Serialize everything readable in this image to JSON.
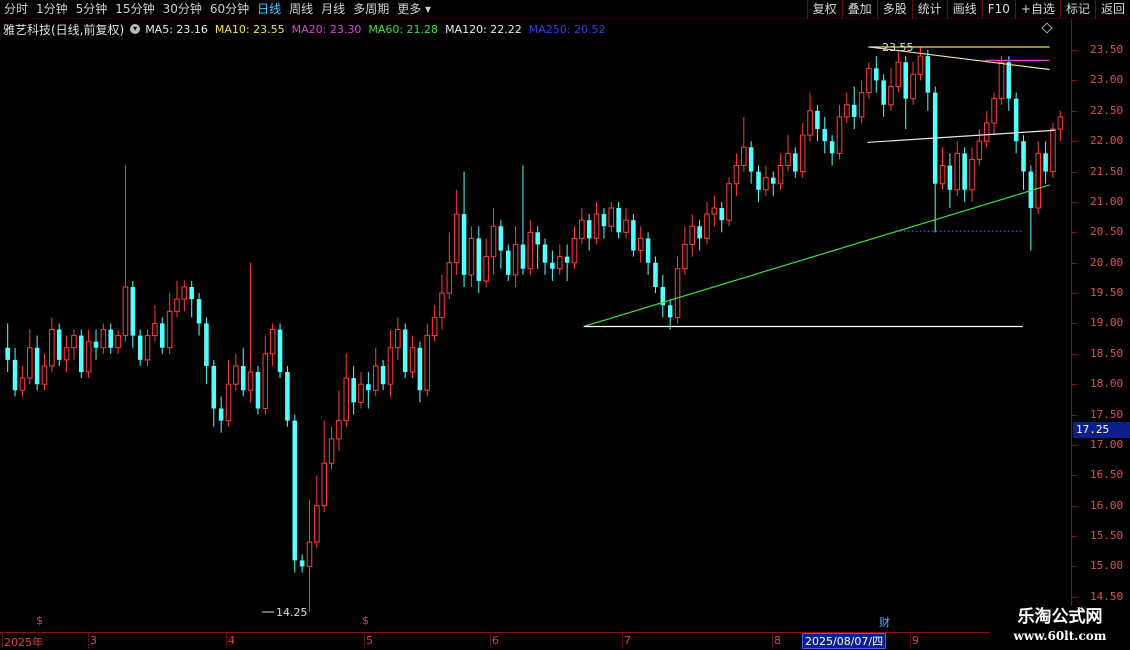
{
  "toolbar": {
    "timeframes": [
      "分时",
      "1分钟",
      "5分钟",
      "15分钟",
      "30分钟",
      "60分钟",
      "日线",
      "周线",
      "月线",
      "多周期",
      "更多"
    ],
    "active": "日线",
    "more_suffix": "▾",
    "buttons": [
      "复权",
      "叠加",
      "多股",
      "统计",
      "画线",
      "F10",
      "+自选",
      "标记",
      "返回"
    ]
  },
  "legend": {
    "stock_name": "雅艺科技(日线,前复权)",
    "toggle_icon": "chevron-down-icon",
    "items": [
      {
        "label": "MA5: 23.16",
        "color": "#e8e8e8"
      },
      {
        "label": "MA10: 23.55",
        "color": "#f0e050"
      },
      {
        "label": "MA20: 23.30",
        "color": "#e040e0"
      },
      {
        "label": "MA60: 21.28",
        "color": "#40e040"
      },
      {
        "label": "MA120: 22.22",
        "color": "#e8e8e8"
      },
      {
        "label": "MA250: 20.52",
        "color": "#3040f0"
      }
    ]
  },
  "price_axis": {
    "ticks": [
      "23.50",
      "23.00",
      "22.50",
      "22.00",
      "21.50",
      "21.00",
      "20.50",
      "20.00",
      "19.50",
      "19.00",
      "18.50",
      "18.00",
      "17.50",
      "17.00",
      "16.50",
      "16.00",
      "15.50",
      "15.00",
      "14.50"
    ],
    "current_price": "17.25"
  },
  "chart_data": {
    "type": "candlestick",
    "ylim": [
      14.25,
      23.6
    ],
    "up_color": "#ff3c3c",
    "down_color": "#54ffff",
    "annotations": {
      "high_label": "23.55",
      "low_label": "14.25",
      "high_value": 23.55,
      "low_value": 14.25
    },
    "candles": [
      [
        18.6,
        18.4,
        19.0,
        18.2
      ],
      [
        18.4,
        17.9,
        18.6,
        17.8
      ],
      [
        17.9,
        18.1,
        18.3,
        17.8
      ],
      [
        18.1,
        18.6,
        18.9,
        18.0
      ],
      [
        18.6,
        18.0,
        18.8,
        17.9
      ],
      [
        18.0,
        18.3,
        18.5,
        17.9
      ],
      [
        18.3,
        18.9,
        19.1,
        18.2
      ],
      [
        18.9,
        18.4,
        19.0,
        18.3
      ],
      [
        18.4,
        18.6,
        18.8,
        18.2
      ],
      [
        18.6,
        18.8,
        18.9,
        18.4
      ],
      [
        18.8,
        18.2,
        18.9,
        18.1
      ],
      [
        18.2,
        18.7,
        18.9,
        18.1
      ],
      [
        18.7,
        18.6,
        18.9,
        18.4
      ],
      [
        18.6,
        18.9,
        19.0,
        18.5
      ],
      [
        18.9,
        18.6,
        19.0,
        18.5
      ],
      [
        18.6,
        18.8,
        18.9,
        18.5
      ],
      [
        18.8,
        19.6,
        21.6,
        18.7
      ],
      [
        19.6,
        18.8,
        19.7,
        18.6
      ],
      [
        18.8,
        18.4,
        18.9,
        18.3
      ],
      [
        18.4,
        18.8,
        18.9,
        18.3
      ],
      [
        18.8,
        19.0,
        19.3,
        18.7
      ],
      [
        19.0,
        18.6,
        19.1,
        18.5
      ],
      [
        18.6,
        19.2,
        19.5,
        18.5
      ],
      [
        19.2,
        19.4,
        19.7,
        19.1
      ],
      [
        19.4,
        19.6,
        19.7,
        19.2
      ],
      [
        19.6,
        19.4,
        19.7,
        19.1
      ],
      [
        19.4,
        19.0,
        19.5,
        18.8
      ],
      [
        19.0,
        18.3,
        19.1,
        18.0
      ],
      [
        18.3,
        17.6,
        18.4,
        17.3
      ],
      [
        17.6,
        17.4,
        17.8,
        17.2
      ],
      [
        17.4,
        18.0,
        18.4,
        17.3
      ],
      [
        18.0,
        18.3,
        18.5,
        17.9
      ],
      [
        18.3,
        17.9,
        18.6,
        17.8
      ],
      [
        17.9,
        18.2,
        20.0,
        17.7
      ],
      [
        18.2,
        17.6,
        18.3,
        17.5
      ],
      [
        17.6,
        18.5,
        18.8,
        17.5
      ],
      [
        18.5,
        18.9,
        19.0,
        18.3
      ],
      [
        18.9,
        18.2,
        19.0,
        18.1
      ],
      [
        18.2,
        17.4,
        18.3,
        17.3
      ],
      [
        17.4,
        15.1,
        17.5,
        14.9
      ],
      [
        15.1,
        15.0,
        15.2,
        14.9
      ],
      [
        15.0,
        15.4,
        16.1,
        14.25
      ],
      [
        15.4,
        16.0,
        16.5,
        15.3
      ],
      [
        16.0,
        16.7,
        17.4,
        15.9
      ],
      [
        16.7,
        17.1,
        17.3,
        16.6
      ],
      [
        17.1,
        17.4,
        17.9,
        16.9
      ],
      [
        17.4,
        18.1,
        18.5,
        17.3
      ],
      [
        18.1,
        17.7,
        18.3,
        17.5
      ],
      [
        17.7,
        18.0,
        18.2,
        17.6
      ],
      [
        18.0,
        17.9,
        18.2,
        17.6
      ],
      [
        17.9,
        18.3,
        18.6,
        17.8
      ],
      [
        18.3,
        18.0,
        18.4,
        17.9
      ],
      [
        18.0,
        18.6,
        18.9,
        17.8
      ],
      [
        18.6,
        18.9,
        19.1,
        18.4
      ],
      [
        18.9,
        18.2,
        19.0,
        18.1
      ],
      [
        18.2,
        18.6,
        18.8,
        18.1
      ],
      [
        18.6,
        17.9,
        18.7,
        17.7
      ],
      [
        17.9,
        18.8,
        19.0,
        17.8
      ],
      [
        18.8,
        19.1,
        19.3,
        18.7
      ],
      [
        19.1,
        19.5,
        19.8,
        18.9
      ],
      [
        19.5,
        20.0,
        20.5,
        19.4
      ],
      [
        20.0,
        20.8,
        21.2,
        19.8
      ],
      [
        20.8,
        19.8,
        21.5,
        19.6
      ],
      [
        19.8,
        20.4,
        20.6,
        19.6
      ],
      [
        20.4,
        19.7,
        20.6,
        19.5
      ],
      [
        19.7,
        20.1,
        20.4,
        19.6
      ],
      [
        20.1,
        20.6,
        20.9,
        19.8
      ],
      [
        20.6,
        20.2,
        20.7,
        19.9
      ],
      [
        20.2,
        19.8,
        20.3,
        19.7
      ],
      [
        19.8,
        20.3,
        20.6,
        19.6
      ],
      [
        20.3,
        19.9,
        21.6,
        19.8
      ],
      [
        19.9,
        20.5,
        20.7,
        19.8
      ],
      [
        20.5,
        20.3,
        20.6,
        19.9
      ],
      [
        20.3,
        20.0,
        20.4,
        19.8
      ],
      [
        20.0,
        19.9,
        20.2,
        19.7
      ],
      [
        19.9,
        20.1,
        20.3,
        19.8
      ],
      [
        20.1,
        20.0,
        20.3,
        19.7
      ],
      [
        20.0,
        20.4,
        20.6,
        19.9
      ],
      [
        20.4,
        20.7,
        20.9,
        20.3
      ],
      [
        20.7,
        20.4,
        20.8,
        20.2
      ],
      [
        20.4,
        20.8,
        21.0,
        20.3
      ],
      [
        20.8,
        20.6,
        20.9,
        20.4
      ],
      [
        20.6,
        20.9,
        21.0,
        20.5
      ],
      [
        20.9,
        20.5,
        21.0,
        20.4
      ],
      [
        20.5,
        20.7,
        20.9,
        20.4
      ],
      [
        20.7,
        20.2,
        20.8,
        20.1
      ],
      [
        20.2,
        20.4,
        20.6,
        20.0
      ],
      [
        20.4,
        20.0,
        20.5,
        19.8
      ],
      [
        20.0,
        19.6,
        20.1,
        19.5
      ],
      [
        19.6,
        19.3,
        19.8,
        19.1
      ],
      [
        19.3,
        19.1,
        19.4,
        18.9
      ],
      [
        19.1,
        19.9,
        20.1,
        19.0
      ],
      [
        19.9,
        20.3,
        20.6,
        19.8
      ],
      [
        20.3,
        20.6,
        20.8,
        20.1
      ],
      [
        20.6,
        20.4,
        20.7,
        20.2
      ],
      [
        20.4,
        20.8,
        21.0,
        20.3
      ],
      [
        20.8,
        20.9,
        21.1,
        20.6
      ],
      [
        20.9,
        20.7,
        21.0,
        20.5
      ],
      [
        20.7,
        21.3,
        21.4,
        20.6
      ],
      [
        21.3,
        21.6,
        21.8,
        21.1
      ],
      [
        21.6,
        21.9,
        22.4,
        21.5
      ],
      [
        21.9,
        21.5,
        22.0,
        21.3
      ],
      [
        21.5,
        21.2,
        21.6,
        21.0
      ],
      [
        21.2,
        21.4,
        21.6,
        21.1
      ],
      [
        21.4,
        21.3,
        21.5,
        21.1
      ],
      [
        21.3,
        21.6,
        21.8,
        21.2
      ],
      [
        21.6,
        21.8,
        22.1,
        21.5
      ],
      [
        21.8,
        21.5,
        21.9,
        21.4
      ],
      [
        21.5,
        22.1,
        22.3,
        21.4
      ],
      [
        22.1,
        22.5,
        22.8,
        22.0
      ],
      [
        22.5,
        22.2,
        22.6,
        22.0
      ],
      [
        22.2,
        22.0,
        22.4,
        21.8
      ],
      [
        22.0,
        21.8,
        22.1,
        21.6
      ],
      [
        21.8,
        22.4,
        22.6,
        21.7
      ],
      [
        22.4,
        22.6,
        22.8,
        22.3
      ],
      [
        22.6,
        22.4,
        22.9,
        22.2
      ],
      [
        22.4,
        22.8,
        23.0,
        22.3
      ],
      [
        22.8,
        23.2,
        23.3,
        22.7
      ],
      [
        23.2,
        23.0,
        23.4,
        22.8
      ],
      [
        23.0,
        22.6,
        23.1,
        22.4
      ],
      [
        22.6,
        22.9,
        23.2,
        22.5
      ],
      [
        22.9,
        23.3,
        23.5,
        22.8
      ],
      [
        23.3,
        22.7,
        23.4,
        22.2
      ],
      [
        22.7,
        23.1,
        23.3,
        22.6
      ],
      [
        23.1,
        23.4,
        23.55,
        23.0
      ],
      [
        23.4,
        22.8,
        23.5,
        22.5
      ],
      [
        22.8,
        21.3,
        22.9,
        20.5
      ],
      [
        21.3,
        21.6,
        21.9,
        21.2
      ],
      [
        21.6,
        21.2,
        21.8,
        20.9
      ],
      [
        21.2,
        21.8,
        22.0,
        21.1
      ],
      [
        21.8,
        21.2,
        21.9,
        21.0
      ],
      [
        21.2,
        21.7,
        21.9,
        21.0
      ],
      [
        21.7,
        22.0,
        22.2,
        21.6
      ],
      [
        22.0,
        22.3,
        22.5,
        21.9
      ],
      [
        22.3,
        22.7,
        22.8,
        22.1
      ],
      [
        22.7,
        23.3,
        23.4,
        22.6
      ],
      [
        23.3,
        22.7,
        23.4,
        22.5
      ],
      [
        22.7,
        22.0,
        22.8,
        21.8
      ],
      [
        22.0,
        21.5,
        22.1,
        21.2
      ],
      [
        21.5,
        20.9,
        21.6,
        20.2
      ],
      [
        20.9,
        21.8,
        22.0,
        20.8
      ],
      [
        21.8,
        21.5,
        22.0,
        21.3
      ],
      [
        21.5,
        22.2,
        22.3,
        21.4
      ],
      [
        22.2,
        22.4,
        22.5,
        22.0
      ]
    ],
    "overlays": [
      {
        "name": "upper-trendline",
        "color": "#f0e8a0",
        "points": [
          [
            0.812,
            23.55
          ],
          [
            0.98,
            23.18
          ]
        ]
      },
      {
        "name": "yellow-line",
        "color": "#f0e040",
        "points": [
          [
            0.812,
            23.55
          ],
          [
            0.98,
            23.55
          ]
        ]
      },
      {
        "name": "magenta-line",
        "color": "#e040e0",
        "points": [
          [
            0.92,
            23.33
          ],
          [
            0.98,
            23.33
          ]
        ]
      },
      {
        "name": "white-trendline",
        "color": "#e8e8e8",
        "points": [
          [
            0.81,
            21.98
          ],
          [
            0.985,
            22.18
          ]
        ]
      },
      {
        "name": "green-trendline",
        "color": "#40e040",
        "points": [
          [
            0.545,
            18.95
          ],
          [
            0.98,
            21.28
          ]
        ]
      },
      {
        "name": "support-line",
        "color": "#ffffff",
        "points": [
          [
            0.545,
            18.95
          ],
          [
            0.955,
            18.95
          ]
        ]
      },
      {
        "name": "blue-dotted-line",
        "color": "#3050ff",
        "dash": true,
        "points": [
          [
            0.84,
            20.52
          ],
          [
            0.955,
            20.52
          ]
        ]
      }
    ]
  },
  "date_axis": {
    "labels": [
      "2025年",
      "3",
      "4",
      "5",
      "6",
      "7",
      "8",
      "9"
    ],
    "highlight": "2025/08/07/四"
  },
  "event_marks": [
    {
      "text": "$",
      "kind": "div"
    },
    {
      "text": "$",
      "kind": "div"
    },
    {
      "text": "财",
      "kind": "fin"
    }
  ],
  "watermark": {
    "title": "乐淘公式网",
    "url": "www.60lt.com"
  }
}
